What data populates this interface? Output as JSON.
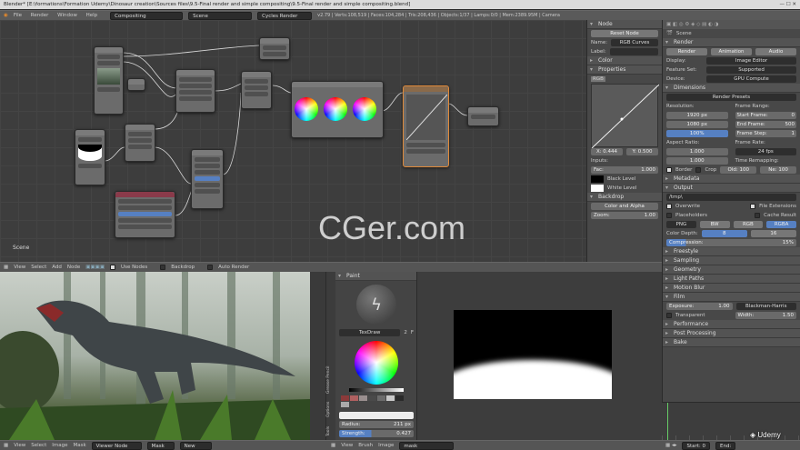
{
  "titlebar": {
    "text": "Blender* [E:\\formations\\Formation Udemy\\Dinosaur creation\\Sources files\\9.5-Final render and simple compositing\\9.5-Final render and simple compositing.blend]"
  },
  "infobar": {
    "menus": [
      "File",
      "Render",
      "Window",
      "Help"
    ],
    "layout": "Compositing",
    "scene": "Scene",
    "engine": "Cycles Render",
    "stats": "v2.79 | Verts:108,519 | Faces:104,284 | Tris:208,436 | Objects:1/37 | Lamps:0/0 | Mem:2389.95M | Camera"
  },
  "node_editor": {
    "scene_label": "Scene",
    "watermark": "CGer.com",
    "header_menus": [
      "View",
      "Select",
      "Add",
      "Node"
    ],
    "use_nodes": "Use Nodes",
    "backdrop": "Backdrop",
    "auto_render": "Auto Render"
  },
  "node_panel": {
    "section_node": "Node",
    "reset_node": "Reset Node",
    "name_label": "Name:",
    "name_value": "RGB Curves",
    "label_label": "Label:",
    "section_color": "Color",
    "section_properties": "Properties",
    "channel_rgb": "RGB",
    "curve_x": "X: 0.444",
    "curve_y": "Y: 0.500",
    "inputs_label": "Inputs:",
    "fac_label": "Fac:",
    "fac_value": "1.000",
    "black_level": "Black Level",
    "white_level": "White Level",
    "section_backdrop": "Backdrop",
    "color_alpha": "Color and Alpha",
    "zoom_label": "Zoom:",
    "zoom_value": "1.00"
  },
  "properties": {
    "scene_name": "Scene",
    "section_render": "Render",
    "tabs": [
      "Render",
      "Animation",
      "Audio"
    ],
    "display_label": "Display:",
    "display_value": "Image Editor",
    "feature_label": "Feature Set:",
    "feature_value": "Supported",
    "device_label": "Device:",
    "device_value": "GPU Compute",
    "section_dimensions": "Dimensions",
    "render_presets": "Render Presets",
    "resolution_label": "Resolution:",
    "res_x": "1920 px",
    "res_y": "1080 px",
    "res_pct": "100%",
    "frame_range_label": "Frame Range:",
    "start_frame": "Start Frame:",
    "start_val": "0",
    "end_frame": "End Frame:",
    "end_val": "500",
    "frame_step": "Frame Step:",
    "step_val": "1",
    "aspect_label": "Aspect Ratio:",
    "aspect_x": "1.000",
    "aspect_y": "1.000",
    "frame_rate_label": "Frame Rate:",
    "fps": "24 fps",
    "time_remap": "Time Remapping:",
    "old": "Old: 100",
    "new": "Ne: 100",
    "border": "Border",
    "crop": "Crop",
    "section_metadata": "Metadata",
    "section_output": "Output",
    "output_path": "/tmp\\",
    "overwrite": "Overwrite",
    "file_ext": "File Extensions",
    "placeholders": "Placeholders",
    "cache_result": "Cache Result",
    "format": "PNG",
    "bw": "BW",
    "rgb": "RGB",
    "rgba": "RGBA",
    "color_depth": "Color Depth:",
    "depth8": "8",
    "depth16": "16",
    "compression": "Compression:",
    "comp_val": "15%",
    "collapsed": [
      "Freestyle",
      "Sampling",
      "Geometry",
      "Light Paths",
      "Motion Blur"
    ],
    "section_film": "Film",
    "exposure": "Exposure:",
    "exposure_val": "1.00",
    "filter": "Blackman-Harris",
    "transparent": "Transparent",
    "width": "Width:",
    "width_val": "1.50",
    "collapsed2": [
      "Performance",
      "Post Processing",
      "Bake"
    ]
  },
  "image_editor": {
    "menus": [
      "View",
      "Select",
      "Image",
      "Mask"
    ],
    "slot": "Viewer Node",
    "mask": "Mask",
    "new": "New"
  },
  "paint_panel": {
    "title": "Paint",
    "brush": "TexDraw",
    "brush_users": "2",
    "f": "F",
    "radius_label": "Radius:",
    "radius_val": "211 px",
    "strength_label": "Strength:",
    "strength_val": "0.427",
    "tabs": [
      "Tools",
      "Options",
      "Grease Pencil"
    ],
    "swatches": [
      "#8b3a3a",
      "#b06060",
      "#9a8f8f",
      "#4a4a4a",
      "#6b6b6b",
      "#c8c8c8",
      "#2a2a2a",
      "#aaaaaa"
    ]
  },
  "mask_editor": {
    "menus": [
      "View",
      "Brush",
      "Image"
    ],
    "mask": "mask"
  },
  "timeline": {
    "start_label": "Start:",
    "start_val": "0",
    "end_label": "End:"
  },
  "udemy": "Udemy"
}
